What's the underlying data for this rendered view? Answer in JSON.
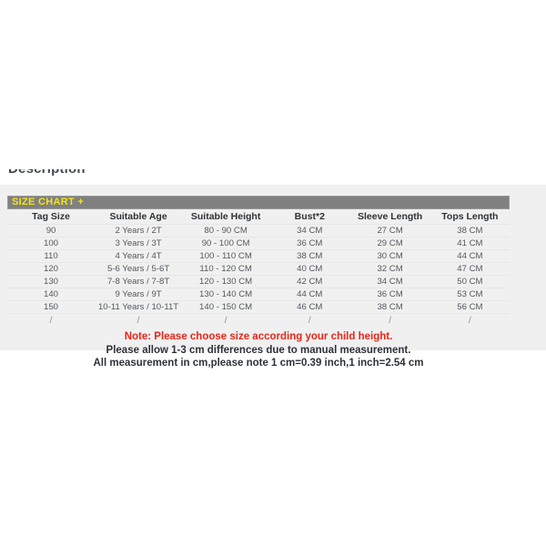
{
  "page": {
    "section_heading": "Description",
    "background_color": "#ffffff",
    "panel_color": "#f0f0f0"
  },
  "size_chart": {
    "banner_label": "SIZE CHART +",
    "banner_bg_color": "#808080",
    "banner_text_color": "#f2e318",
    "columns": [
      "Tag Size",
      "Suitable Age",
      "Suitable Height",
      "Bust*2",
      "Sleeve Length",
      "Tops Length"
    ],
    "rows": [
      [
        "90",
        "2 Years / 2T",
        "80 - 90 CM",
        "34 CM",
        "27 CM",
        "38 CM"
      ],
      [
        "100",
        "3 Years / 3T",
        "90 - 100 CM",
        "36 CM",
        "29 CM",
        "41 CM"
      ],
      [
        "110",
        "4 Years / 4T",
        "100 - 110 CM",
        "38 CM",
        "30 CM",
        "44 CM"
      ],
      [
        "120",
        "5-6 Years / 5-6T",
        "110 - 120 CM",
        "40 CM",
        "32 CM",
        "47 CM"
      ],
      [
        "130",
        "7-8 Years / 7-8T",
        "120 - 130 CM",
        "42 CM",
        "34 CM",
        "50 CM"
      ],
      [
        "140",
        "9 Years / 9T",
        "130 - 140 CM",
        "44 CM",
        "36 CM",
        "53 CM"
      ],
      [
        "150",
        "10-11 Years / 10-11T",
        "140 - 150 CM",
        "46 CM",
        "38 CM",
        "56 CM"
      ],
      [
        "/",
        "/",
        "/",
        "/",
        "/",
        "/"
      ]
    ]
  },
  "notes": {
    "line1": "Note: Please choose size according your child height.",
    "line2": "Please allow 1-3 cm differences due to manual measurement.",
    "line3": "All measurement in cm,please note 1 cm=0.39 inch,1 inch=2.54 cm",
    "line1_color": "#e8261a"
  }
}
